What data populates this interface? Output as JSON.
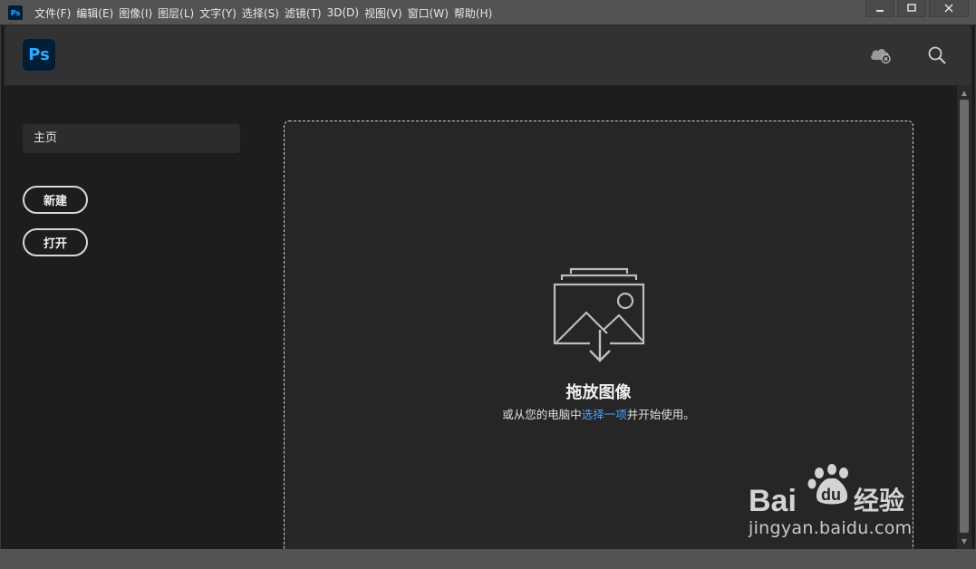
{
  "app": {
    "mini_logo": "Ps",
    "logo": "Ps"
  },
  "menu": [
    "文件(F)",
    "编辑(E)",
    "图像(I)",
    "图层(L)",
    "文字(Y)",
    "选择(S)",
    "滤镜(T)",
    "3D(D)",
    "视图(V)",
    "窗口(W)",
    "帮助(H)"
  ],
  "window_controls": {
    "minimize": "minimize-icon",
    "maximize": "maximize-icon",
    "close": "close-icon"
  },
  "header": {
    "icons": [
      "cloud-error-icon",
      "search-icon"
    ]
  },
  "sidebar": {
    "home_label": "主页",
    "new_label": "新建",
    "open_label": "打开"
  },
  "drop_zone": {
    "title": "拖放图像",
    "subtitle_before": "或从您的电脑中",
    "subtitle_link": "选择一项",
    "subtitle_after": "并开始使用。"
  },
  "watermark": {
    "logo_text": "Bai du 经验",
    "url": "jingyan.baidu.com"
  },
  "colors": {
    "accent_blue": "#31a8ff",
    "link": "#4aa3ff",
    "logo_bg": "#001e36"
  }
}
